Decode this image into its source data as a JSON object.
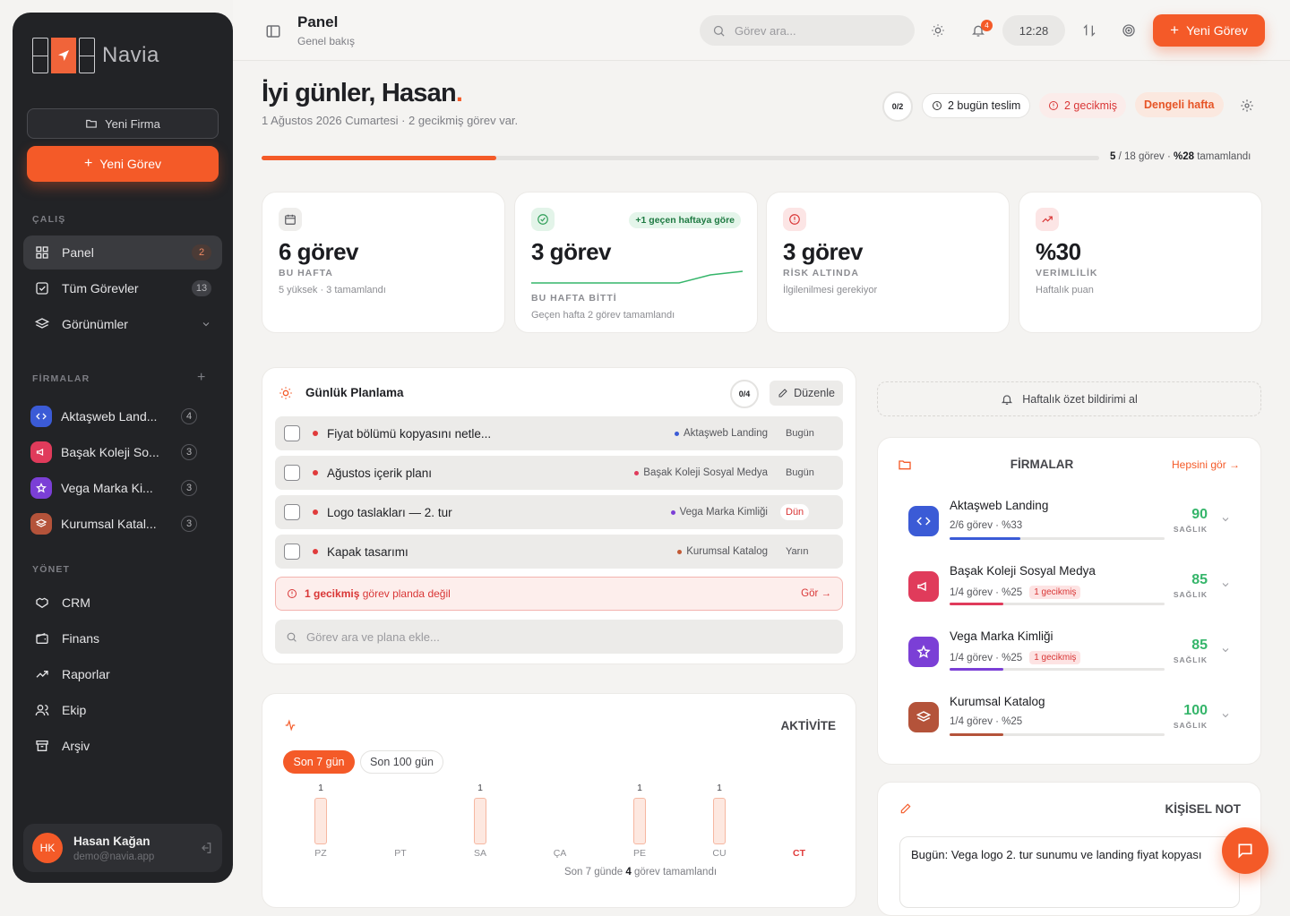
{
  "brand": {
    "name": "Navia"
  },
  "sidebar": {
    "new_firm": "Yeni Firma",
    "new_task": "Yeni Görev",
    "sec_work": "ÇALIŞ",
    "nav": [
      {
        "label": "Panel",
        "count": "2"
      },
      {
        "label": "Tüm Görevler",
        "count": "13"
      },
      {
        "label": "Görünümler"
      }
    ],
    "sec_firms": "FİRMALAR",
    "firms": [
      {
        "label": "Aktaşweb Land...",
        "count": "4"
      },
      {
        "label": "Başak Koleji So...",
        "count": "3"
      },
      {
        "label": "Vega Marka Ki...",
        "count": "3"
      },
      {
        "label": "Kurumsal Katal...",
        "count": "3"
      }
    ],
    "sec_manage": "YÖNET",
    "manage": [
      {
        "label": "CRM"
      },
      {
        "label": "Finans"
      },
      {
        "label": "Raporlar"
      },
      {
        "label": "Ekip"
      },
      {
        "label": "Arşiv"
      }
    ],
    "user": {
      "initials": "HK",
      "name": "Hasan Kağan",
      "email": "demo@navia.app"
    }
  },
  "topbar": {
    "title": "Panel",
    "subtitle": "Genel bakış",
    "search_placeholder": "Görev ara...",
    "notif_count": "4",
    "time": "12:28",
    "new_task": "Yeni Görev"
  },
  "hero": {
    "greeting": "İyi günler, Hasan",
    "dot": ".",
    "date": "1 Ağustos 2026 Cumartesi",
    "note": "2 gecikmiş görev var.",
    "ring": "0/2",
    "due_today": "2 bugün teslim",
    "overdue": "2 gecikmiş",
    "balance": "Dengeli hafta",
    "progress": {
      "done": "5",
      "total": "/ 18 görev ·",
      "pct": "%28",
      "suffix": "tamamlandı",
      "value": 0.28
    }
  },
  "kpis": [
    {
      "big": "6 görev",
      "label": "BU HAFTA",
      "sub": "5 yüksek · 3 tamamlandı"
    },
    {
      "big": "3 görev",
      "badge": "+1 geçen haftaya göre",
      "label": "BU HAFTA BİTTİ",
      "sub": "Geçen hafta 2 görev tamamlandı"
    },
    {
      "big": "3 görev",
      "label": "RİSK ALTINDA",
      "sub": "İlgilenilmesi gerekiyor"
    },
    {
      "big": "%30",
      "label": "VERİMLİLİK",
      "sub": "Haftalık puan"
    }
  ],
  "planning": {
    "title": "Günlük Planlama",
    "ring": "0/4",
    "edit": "Düzenle",
    "tasks": [
      {
        "title": "Fiyat bölümü kopyasını netle...",
        "firm": "Aktaşweb Landing",
        "firm_color": "#3b5bd6",
        "date": "Bugün"
      },
      {
        "title": "Ağustos içerik planı",
        "firm": "Başak Koleji Sosyal Medya",
        "firm_color": "#e03b5b",
        "date": "Bugün"
      },
      {
        "title": "Logo taslakları — 2. tur",
        "firm": "Vega Marka Kimliği",
        "firm_color": "#7b3fd6",
        "date": "Dün"
      },
      {
        "title": "Kapak tasarımı",
        "firm": "Kurumsal Katalog",
        "firm_color": "#c25a35",
        "date": "Yarın"
      }
    ],
    "alert_strong": "1 gecikmiş",
    "alert_rest": "görev planda değil",
    "alert_link": "Gör",
    "add_placeholder": "Görev ara ve plana ekle..."
  },
  "activity": {
    "title": "AKTİVİTE",
    "tab1": "Son 7 gün",
    "tab2": "Son 100 gün",
    "summary_pre": "Son 7 günde",
    "summary_num": "4",
    "summary_post": "görev tamamlandı",
    "chart_data": {
      "type": "bar",
      "categories": [
        "PZ",
        "PT",
        "SA",
        "ÇA",
        "PE",
        "CU",
        "CT"
      ],
      "values": [
        1,
        0,
        1,
        0,
        1,
        1,
        0
      ],
      "highlight": "CT"
    }
  },
  "weekly": {
    "label": "Haftalık özet bildirimi al"
  },
  "firms_panel": {
    "title": "FİRMALAR",
    "see_all": "Hepsini gör",
    "health_label": "SAĞLIK",
    "overdue_tag": "1 gecikmiş",
    "items": [
      {
        "name": "Aktaşweb Landing",
        "sub": "2/6 görev · %33",
        "progress": 0.33,
        "health": "90",
        "color": "#3b5bd6",
        "overdue": false
      },
      {
        "name": "Başak Koleji Sosyal Medya",
        "sub": "1/4 görev · %25",
        "progress": 0.25,
        "health": "85",
        "color": "#e03b5b",
        "overdue": true
      },
      {
        "name": "Vega Marka Kimliği",
        "sub": "1/4 görev · %25",
        "progress": 0.25,
        "health": "85",
        "color": "#7b3fd6",
        "overdue": true
      },
      {
        "name": "Kurumsal Katalog",
        "sub": "1/4 görev · %25",
        "progress": 0.25,
        "health": "100",
        "color": "#b4533a",
        "overdue": false
      }
    ]
  },
  "note": {
    "title": "KİŞİSEL NOT",
    "text": "Bugün: Vega logo 2. tur sunumu ve landing fiyat kopyası"
  }
}
